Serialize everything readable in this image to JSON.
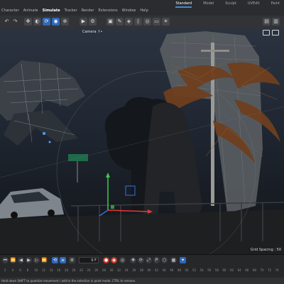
{
  "menu": {
    "items": [
      "Character",
      "Animate",
      "Simulate",
      "Tracker",
      "Render",
      "Extensions",
      "Window",
      "Help"
    ],
    "active_index": 2
  },
  "layouts": {
    "tabs": [
      "Standard",
      "Model",
      "Sculpt",
      "UVEdit",
      "Paint"
    ],
    "active_index": 0
  },
  "viewport": {
    "camera_label": "Camera ↑•",
    "grid_spacing": "Grid Spacing : 50"
  },
  "timeline": {
    "current_frame": "0 F",
    "tick_labels": [
      "2",
      "4",
      "6",
      "8",
      "10",
      "12",
      "14",
      "16",
      "18",
      "20",
      "22",
      "24",
      "26",
      "28",
      "30",
      "32",
      "34",
      "36",
      "38",
      "40",
      "42",
      "44",
      "46",
      "48",
      "50",
      "52",
      "54",
      "56",
      "58",
      "60",
      "62",
      "64",
      "66",
      "68",
      "70",
      "72",
      "74"
    ]
  },
  "statusbar": {
    "text": "Hold down SHIFT to quantize movement / add to the selection in point mode, CTRL to remove."
  },
  "colors": {
    "accent": "#2f68b8",
    "record": "#c0392b",
    "axis_y": "#3ec94a",
    "axis_x": "#e03a3a",
    "axis_z": "#3a6fe0"
  }
}
